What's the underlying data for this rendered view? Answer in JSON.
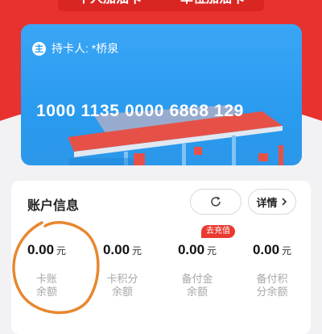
{
  "tabs": [
    "个人加油卡",
    "单位加油卡"
  ],
  "card": {
    "holder_badge": "主",
    "holder_text": "持卡人: *桥泉",
    "card_number": "1000 1135 0000 6868 129"
  },
  "account": {
    "title": "账户信息",
    "detail_label": "详情",
    "recharge_badge": "去充值",
    "unit": "元",
    "stats": [
      {
        "value": "0.00",
        "label_line1": "卡账",
        "label_line2": "余额"
      },
      {
        "value": "0.00",
        "label_line1": "卡积分",
        "label_line2": "余额"
      },
      {
        "value": "0.00",
        "label_line1": "备付金",
        "label_line2": "余额"
      },
      {
        "value": "0.00",
        "label_line1": "备付积",
        "label_line2": "分余额"
      }
    ]
  },
  "colors": {
    "brand_red": "#e8322f",
    "card_blue": "#2a9bef",
    "annotation_orange": "#e8872e"
  },
  "icons": [
    "refresh-icon",
    "chevron-right-icon"
  ]
}
